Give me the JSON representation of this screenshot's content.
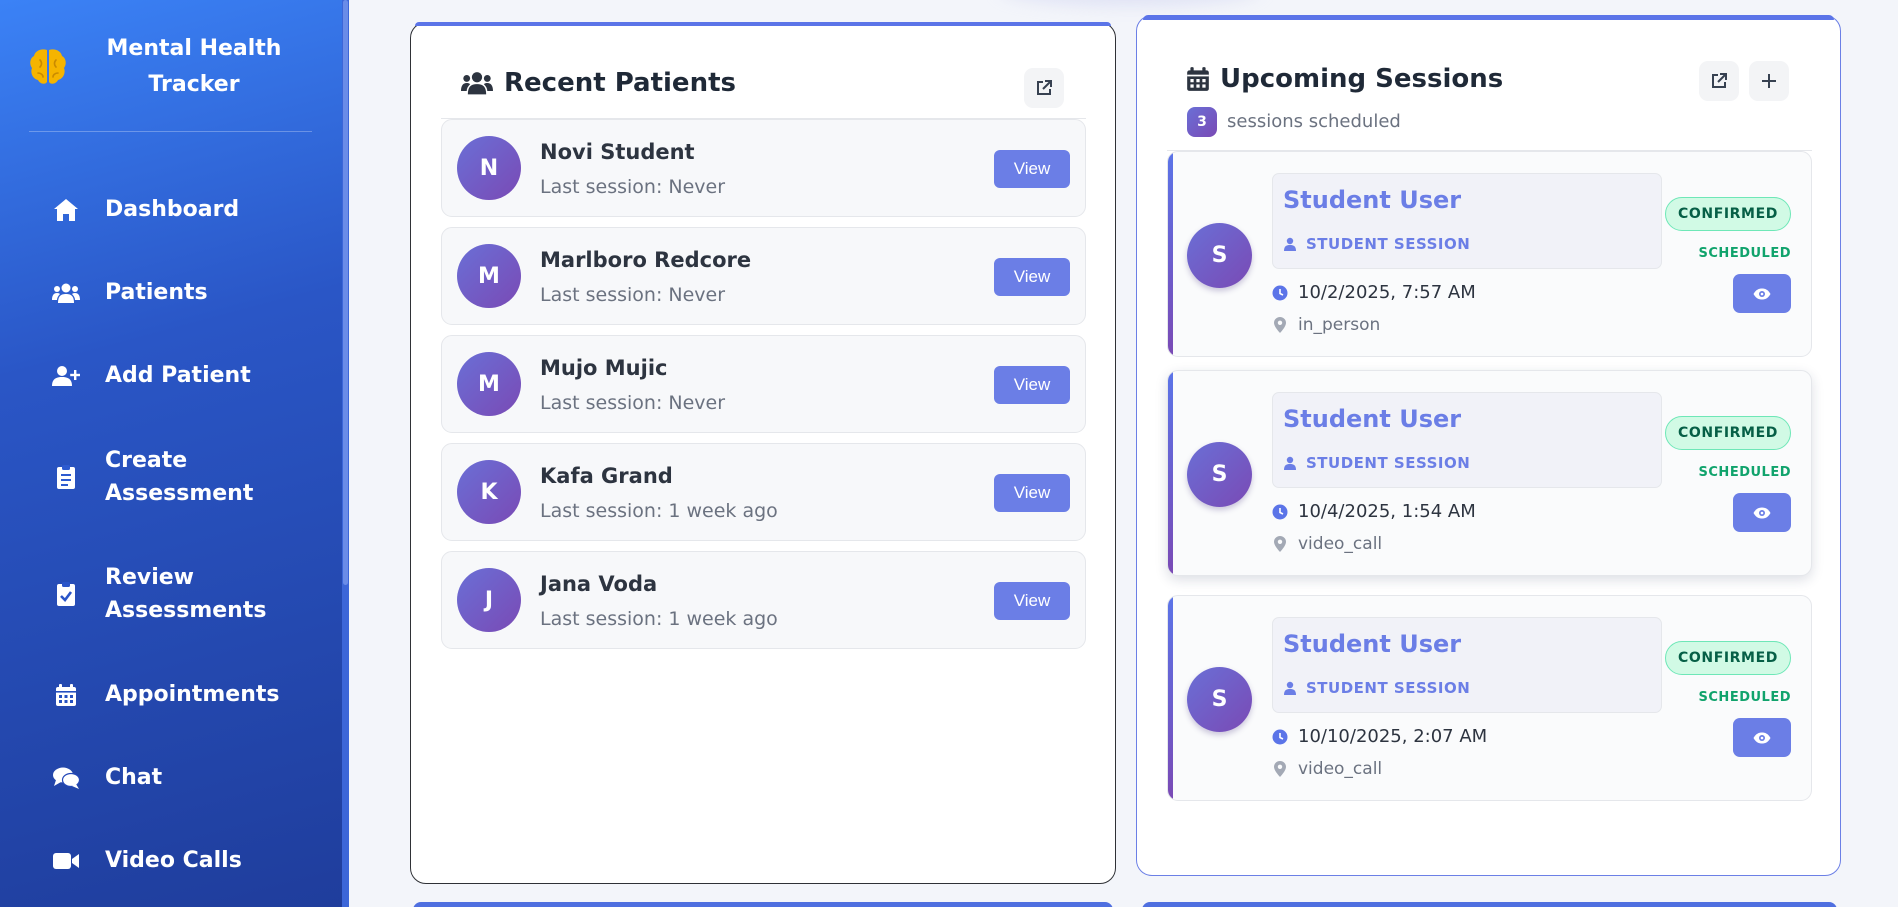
{
  "app": {
    "title": "Mental Health Tracker"
  },
  "sidebar": {
    "items": [
      {
        "label": "Dashboard",
        "icon": "home-icon"
      },
      {
        "label": "Patients",
        "icon": "users-icon"
      },
      {
        "label": "Add Patient",
        "icon": "user-plus-icon"
      },
      {
        "label": "Create Assessment",
        "icon": "clipboard-list-icon"
      },
      {
        "label": "Review Assessments",
        "icon": "clipboard-check-icon"
      },
      {
        "label": "Appointments",
        "icon": "calendar-icon"
      },
      {
        "label": "Chat",
        "icon": "comments-icon"
      },
      {
        "label": "Video Calls",
        "icon": "video-icon"
      }
    ]
  },
  "recent_patients": {
    "title": "Recent Patients",
    "view_label": "View",
    "patients": [
      {
        "initial": "N",
        "name": "Novi Student",
        "last_session": "Last session: Never"
      },
      {
        "initial": "M",
        "name": "Marlboro Redcore",
        "last_session": "Last session: Never"
      },
      {
        "initial": "M",
        "name": "Mujo Mujic",
        "last_session": "Last session: Never"
      },
      {
        "initial": "K",
        "name": "Kafa Grand",
        "last_session": "Last session: 1 week ago"
      },
      {
        "initial": "J",
        "name": "Jana Voda",
        "last_session": "Last session: 1 week ago"
      }
    ]
  },
  "upcoming_sessions": {
    "title": "Upcoming Sessions",
    "count": "3",
    "count_label": "sessions scheduled",
    "sessions": [
      {
        "initial": "S",
        "name": "Student User",
        "type": "STUDENT SESSION",
        "datetime": "10/2/2025, 7:57 AM",
        "location": "in_person",
        "status": "CONFIRMED",
        "state": "SCHEDULED"
      },
      {
        "initial": "S",
        "name": "Student User",
        "type": "STUDENT SESSION",
        "datetime": "10/4/2025, 1:54 AM",
        "location": "video_call",
        "status": "CONFIRMED",
        "state": "SCHEDULED"
      },
      {
        "initial": "S",
        "name": "Student User",
        "type": "STUDENT SESSION",
        "datetime": "10/10/2025, 2:07 AM",
        "location": "video_call",
        "status": "CONFIRMED",
        "state": "SCHEDULED"
      }
    ]
  },
  "colors": {
    "sidebar_top": "#3b82f6",
    "sidebar_bottom": "#1f3d9c",
    "accent": "#6b7ee6",
    "avatar_gradient_start": "#6a6fd6",
    "avatar_gradient_end": "#7a4ab5",
    "confirmed_bg": "#d1fae5",
    "scheduled_text": "#10a36c",
    "logo": "#f5b400"
  }
}
